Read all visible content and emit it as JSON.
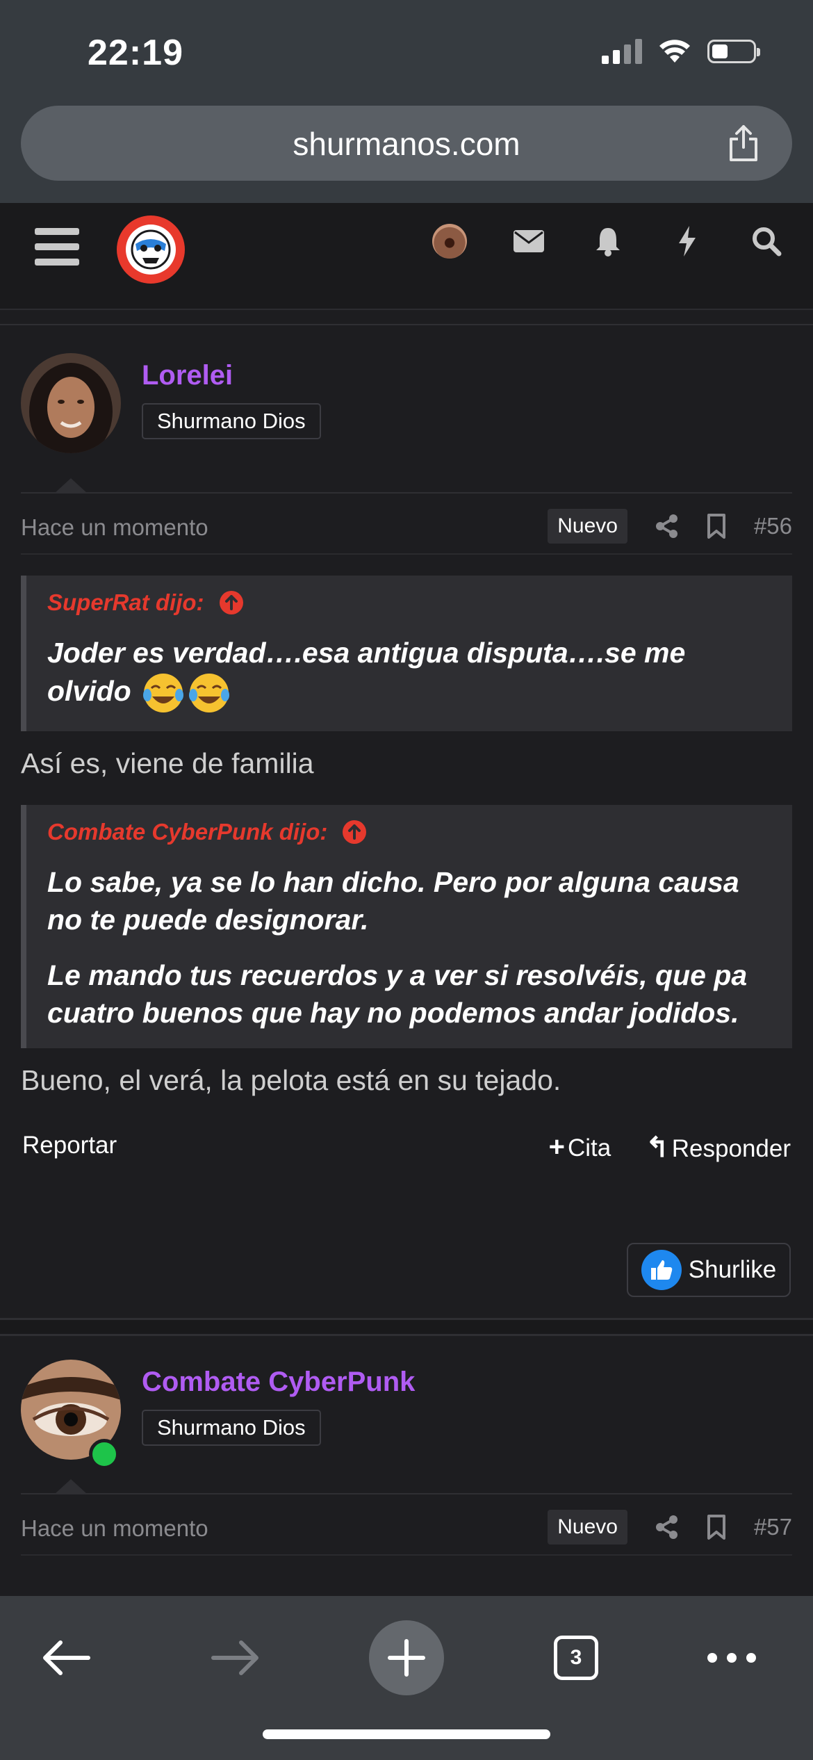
{
  "status": {
    "time": "22:19"
  },
  "browser": {
    "url": "shurmanos.com",
    "open_tabs": "3"
  },
  "posts": [
    {
      "username": "Lorelei",
      "user_title": "Shurmano Dios",
      "time": "Hace un momento",
      "badge": "Nuevo",
      "number": "#56",
      "quotes": [
        {
          "author": "SuperRat dijo:",
          "text": "Joder es verdad….esa antigua disputa….se me olvido"
        },
        {
          "author": "Combate CyberPunk dijo:",
          "text_p1": "Lo sabe, ya se lo han dicho. Pero por alguna causa no te puede designorar.",
          "text_p2": "Le mando tus recuerdos y a ver si resolvéis, que pa cuatro buenos que hay no podemos andar jodidos."
        }
      ],
      "reply_1": "Así es, viene de familia",
      "reply_2": "Bueno, el verá, la pelota está en su tejado.",
      "actions": {
        "report": "Reportar",
        "quote": "Cita",
        "reply": "Responder",
        "like": "Shurlike"
      }
    },
    {
      "username": "Combate CyberPunk",
      "user_title": "Shurmano Dios",
      "time": "Hace un momento",
      "badge": "Nuevo",
      "number": "#57",
      "online": true
    }
  ],
  "colors": {
    "username": "#b05cf2",
    "quote_author": "#e6392d",
    "online": "#1ec44a",
    "like": "#1e88ef"
  }
}
